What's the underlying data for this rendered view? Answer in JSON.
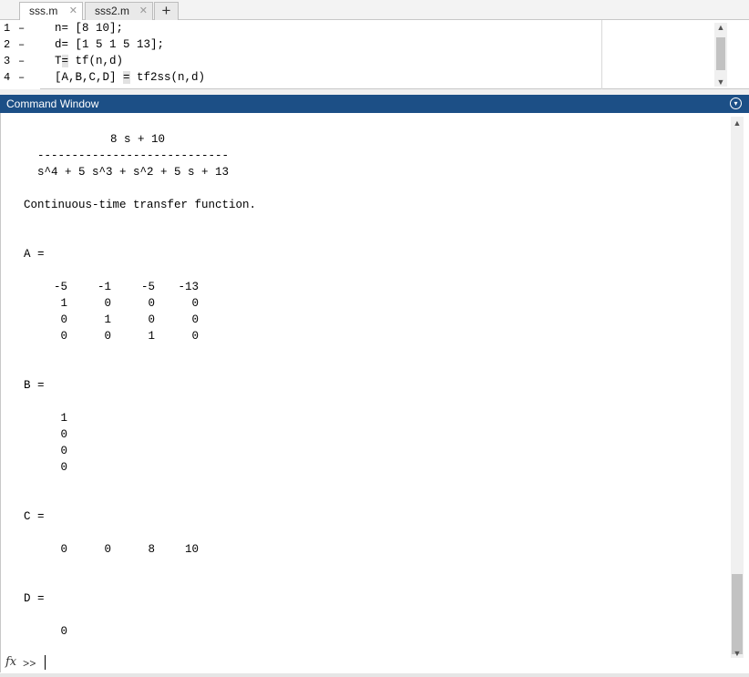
{
  "tabs": [
    {
      "label": "sss.m",
      "active": true
    },
    {
      "label": "sss2.m",
      "active": false
    }
  ],
  "tab_close_glyph": "✕",
  "tab_add_glyph": "+",
  "editor": {
    "lines": [
      {
        "num": "1",
        "marker": "–",
        "code": "n= [8 10];"
      },
      {
        "num": "2",
        "marker": "–",
        "code": "d= [1 5 1 5 13];"
      },
      {
        "num": "3",
        "marker": "–",
        "code": "T= tf(n,d)"
      },
      {
        "num": "4",
        "marker": "–",
        "code": "[A,B,C,D] = tf2ss(n,d)"
      }
    ]
  },
  "command_window": {
    "title": "Command Window",
    "menu_glyph": "▾",
    "tf_numerator": "8 s + 10",
    "tf_divider": "----------------------------",
    "tf_denominator": "s^4 + 5 s^3 + s^2 + 5 s + 13",
    "tf_note": "Continuous-time transfer function.",
    "A_label": "A =",
    "A": [
      [
        "-5",
        "-1",
        "-5",
        "-13"
      ],
      [
        "1",
        "0",
        "0",
        "0"
      ],
      [
        "0",
        "1",
        "0",
        "0"
      ],
      [
        "0",
        "0",
        "1",
        "0"
      ]
    ],
    "B_label": "B =",
    "B": [
      "1",
      "0",
      "0",
      "0"
    ],
    "C_label": "C =",
    "C": [
      "0",
      "0",
      "8",
      "10"
    ],
    "D_label": "D =",
    "D": [
      "0"
    ],
    "fx_icon": "fx",
    "prompt": ">>"
  },
  "colors": {
    "header": "#1c4f86",
    "highlight": "#e1e1e1"
  }
}
